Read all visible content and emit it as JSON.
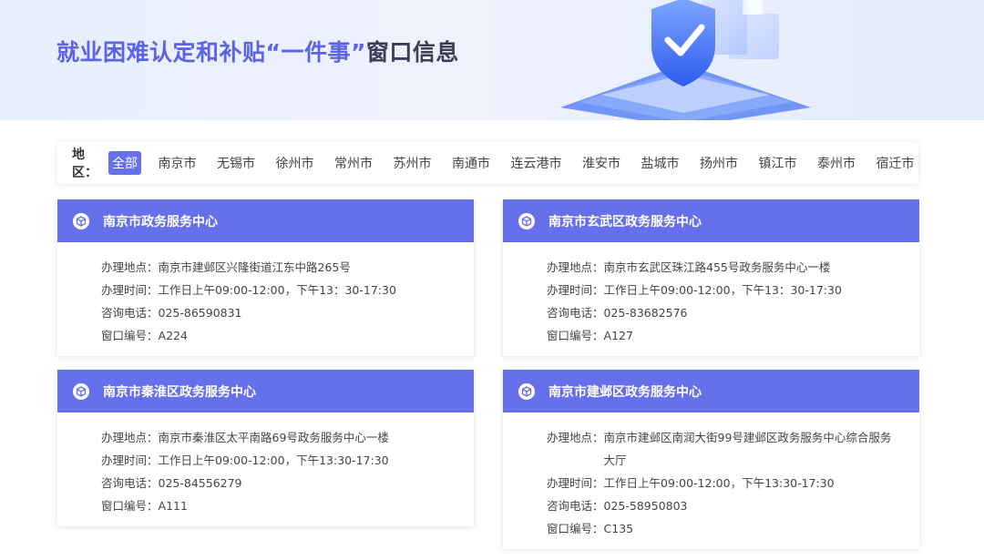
{
  "header": {
    "title_prefix": "就业困难认定和补贴",
    "title_quote": "“一件事”",
    "title_suffix": "窗口信息"
  },
  "filter": {
    "label": "地区：",
    "regions": [
      "全部",
      "南京市",
      "无锡市",
      "徐州市",
      "常州市",
      "苏州市",
      "南通市",
      "连云港市",
      "淮安市",
      "盐城市",
      "扬州市",
      "镇江市",
      "泰州市",
      "宿迁市"
    ],
    "active_index": 0
  },
  "field_labels": {
    "address": "办理地点：",
    "hours": "办理时间：",
    "phone": "咨询电话：",
    "window": "窗口编号："
  },
  "cards": [
    {
      "title": "南京市政务服务中心",
      "address": "南京市建邺区兴隆街道江东中路265号",
      "hours": "工作日上午09:00-12:00，下午13：30-17:30",
      "phone": "025-86590831",
      "window": "A224"
    },
    {
      "title": "南京市玄武区政务服务中心",
      "address": "南京市玄武区珠江路455号政务服务中心一楼",
      "hours": "工作日上午09:00-12:00，下午13：30-17:30",
      "phone": "025-83682576",
      "window": "A127"
    },
    {
      "title": "南京市秦淮区政务服务中心",
      "address": "南京市秦淮区太平南路69号政务服务中心一楼",
      "hours": "工作日上午09:00-12:00，下午13:30-17:30",
      "phone": "025-84556279",
      "window": "A111"
    },
    {
      "title": "南京市建邺区政务服务中心",
      "address": "南京市建邺区南润大街99号建邺区政务服务中心综合服务大厅",
      "hours": "工作日上午09:00-12:00，下午13:30-17:30",
      "phone": "025-58950803",
      "window": "C135"
    }
  ],
  "colors": {
    "accent": "#6670ea",
    "title_highlight": "#5b63e6"
  },
  "icons": {
    "card_icon": "cube-icon",
    "banner_art": "shield-icon"
  }
}
